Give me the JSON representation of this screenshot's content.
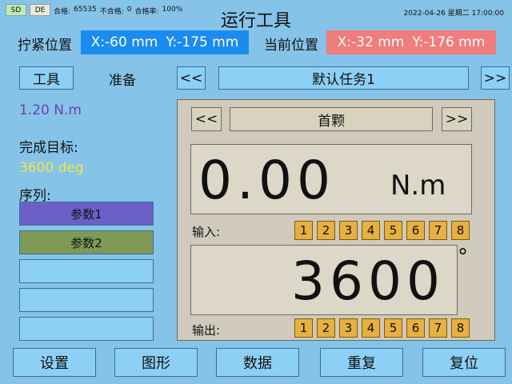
{
  "status": {
    "sd": "SD",
    "de": "DE",
    "pass_label": "合格:",
    "pass_count": "65535",
    "fail_label": "不合格:",
    "fail_count": "0",
    "rate_label": "合格率:",
    "rate": "100%",
    "datetime": "2022-04-26 星期二 17:00:00"
  },
  "title": "运行工具",
  "tighten_position": {
    "label": "拧紧位置",
    "x": "X:-60 mm",
    "y": "Y:-175 mm"
  },
  "current_position": {
    "label": "当前位置",
    "x": "X:-32 mm",
    "y": "Y:-176 mm"
  },
  "left": {
    "tool_button": "工具",
    "state": "准备",
    "torque": "1.20 N.m",
    "target_label": "完成目标:",
    "target_value": "3600 deg",
    "sequence_label": "序列:",
    "sequence": [
      {
        "label": "参数1"
      },
      {
        "label": "参数2"
      },
      {
        "label": ""
      },
      {
        "label": ""
      },
      {
        "label": ""
      }
    ]
  },
  "task": {
    "prev": "<<",
    "name": "默认任务1",
    "next": ">>"
  },
  "panel": {
    "prev": "<<",
    "screw": "首颗",
    "next": ">>",
    "torque_value": "0.00",
    "torque_unit": "N.m",
    "input_label": "输入:",
    "inputs": [
      "1",
      "2",
      "3",
      "4",
      "5",
      "6",
      "7",
      "8"
    ],
    "angle_value": "3600",
    "angle_unit": "°",
    "output_label": "输出:",
    "outputs": [
      "1",
      "2",
      "3",
      "4",
      "5",
      "6",
      "7",
      "8"
    ]
  },
  "bottom": {
    "settings": "设置",
    "graph": "图形",
    "data": "数据",
    "repeat": "重复",
    "reset": "复位"
  },
  "colors": {
    "background": "#86c3e8",
    "tighten_box": "#1a8cf0",
    "current_box": "#f07c7c",
    "seq_param1": "#6c60c8",
    "seq_param2": "#7f9a55",
    "io_chip": "#e7b040",
    "torque_text": "#6b3fb8",
    "target_text": "#f0e64a"
  }
}
